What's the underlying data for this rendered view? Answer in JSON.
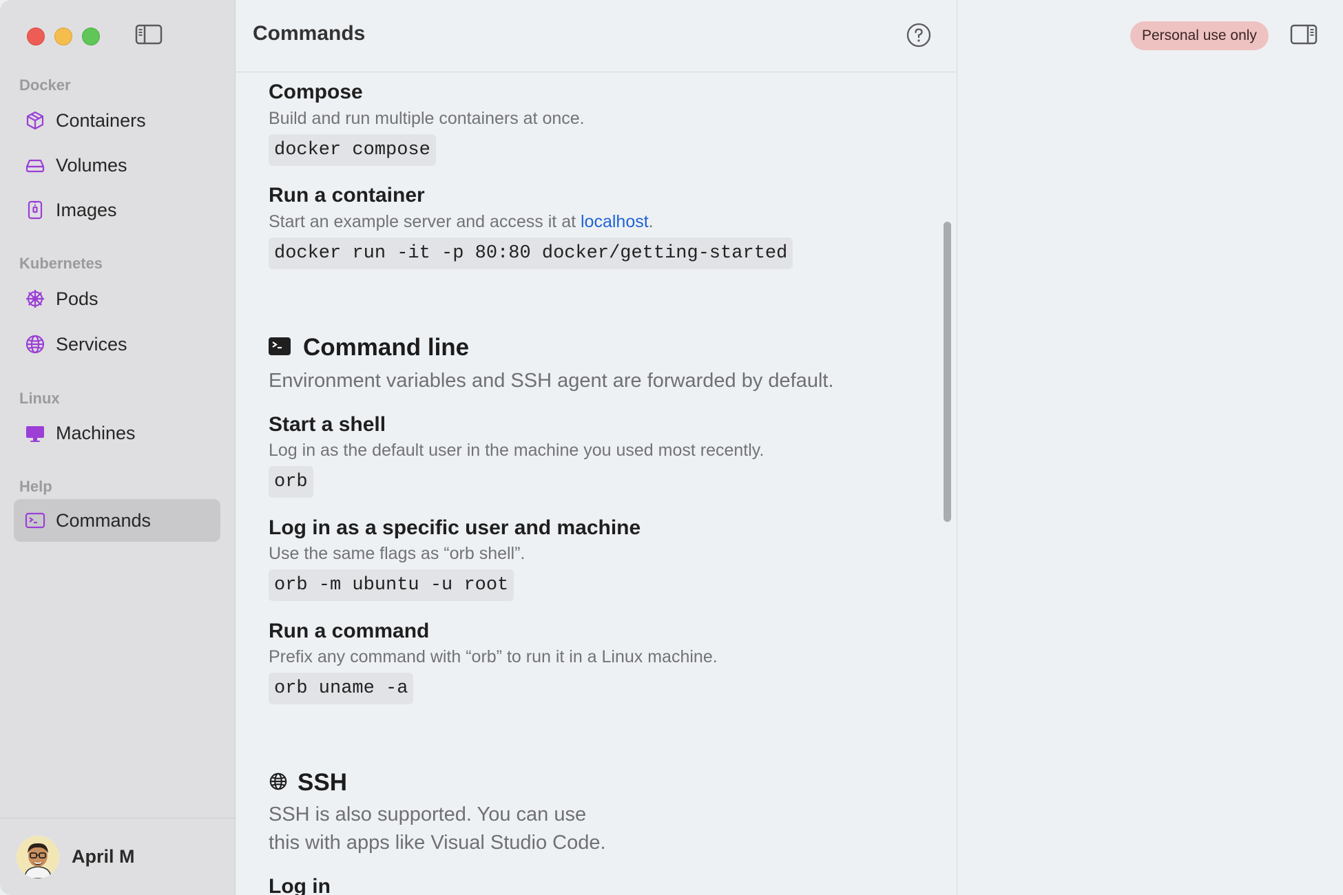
{
  "sidebar": {
    "sections": [
      {
        "label": "Docker"
      },
      {
        "label": "Kubernetes"
      },
      {
        "label": "Linux"
      },
      {
        "label": "Help"
      }
    ],
    "items": [
      {
        "label": "Containers",
        "icon": "cube-icon"
      },
      {
        "label": "Volumes",
        "icon": "drive-icon"
      },
      {
        "label": "Images",
        "icon": "archive-icon"
      },
      {
        "label": "Pods",
        "icon": "helm-wheel-icon"
      },
      {
        "label": "Services",
        "icon": "globe-icon"
      },
      {
        "label": "Machines",
        "icon": "monitor-icon"
      },
      {
        "label": "Commands",
        "icon": "terminal-icon",
        "active": true
      }
    ],
    "user": {
      "name": "April M"
    }
  },
  "main": {
    "title": "Commands",
    "docker_items": [
      {
        "title": "Compose",
        "desc": "Build and run multiple containers at once.",
        "code": "docker compose"
      },
      {
        "title": "Run a container",
        "desc_prefix": "Start an example server and access it at ",
        "link": "localhost",
        "desc_suffix": ".",
        "code": "docker run -it -p 80:80 docker/getting-started"
      }
    ],
    "command_line": {
      "title": "Command line",
      "desc": "Environment variables and SSH agent are forwarded by default.",
      "items": [
        {
          "title": "Start a shell",
          "desc": "Log in as the default user in the machine you used most recently.",
          "code": "orb"
        },
        {
          "title": "Log in as a specific user and machine",
          "desc": "Use the same flags as “orb shell”.",
          "code": "orb -m ubuntu -u root"
        },
        {
          "title": "Run a command",
          "desc": "Prefix any command with “orb” to run it in a Linux machine.",
          "code": "orb uname -a"
        }
      ]
    },
    "ssh": {
      "title": "SSH",
      "desc_line1": "SSH is also supported. You can use",
      "desc_line2": "this with apps like Visual Studio Code.",
      "next_title": "Log in"
    }
  },
  "right_pane": {
    "badge": "Personal use only"
  },
  "colors": {
    "accent_purple": "#9b3fd6",
    "link_blue": "#1f63d6",
    "badge_bg": "#efc2c2"
  }
}
